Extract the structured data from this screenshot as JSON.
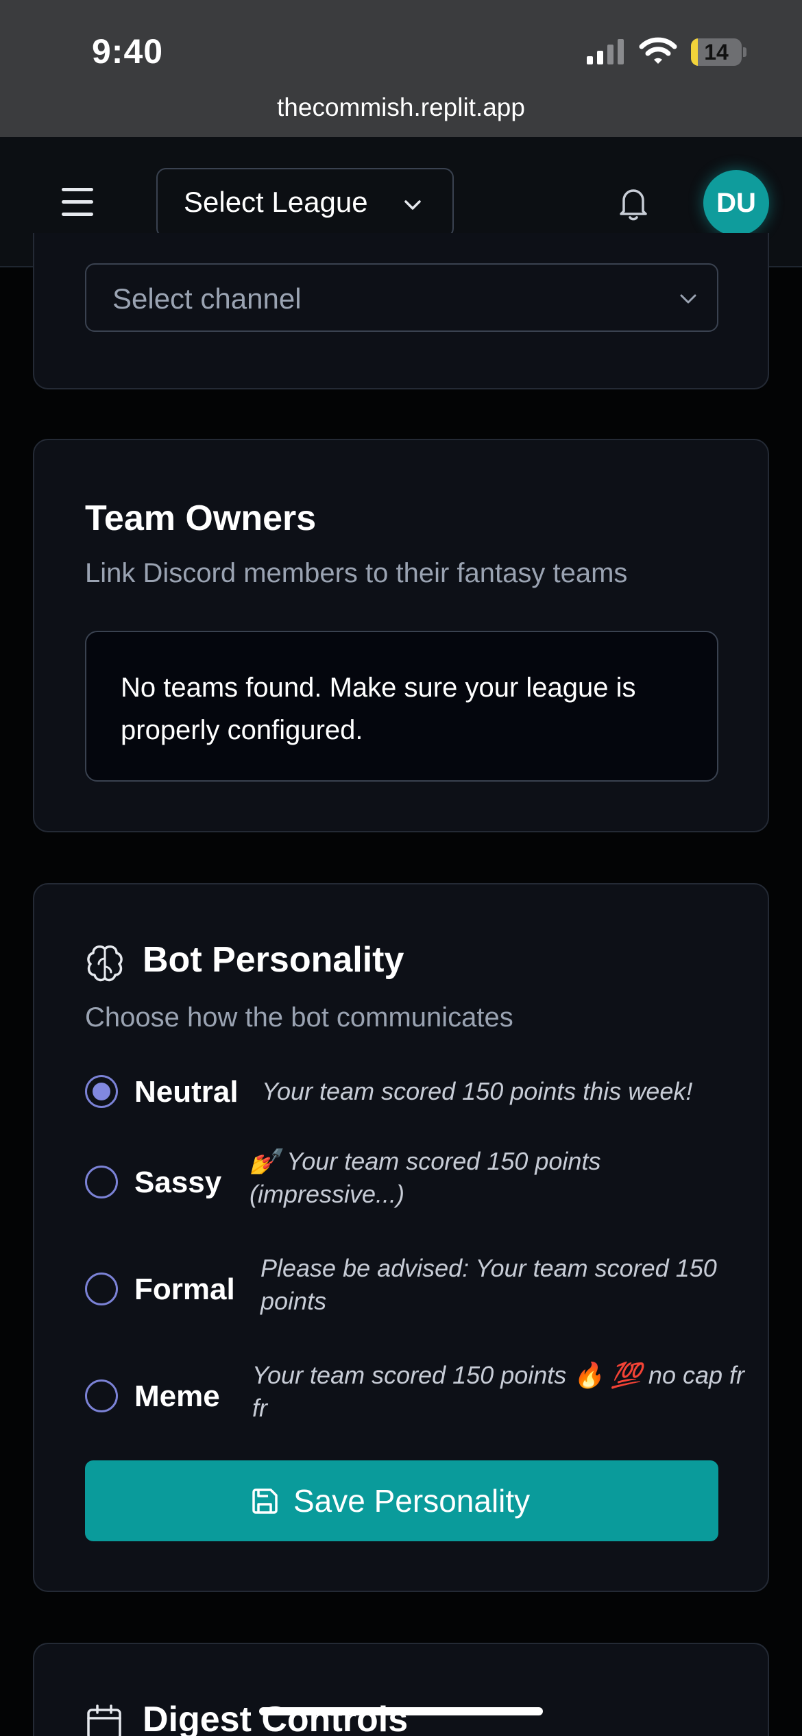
{
  "status": {
    "time": "9:40",
    "battery": "14",
    "battery_level": 0.14
  },
  "browser": {
    "url": "thecommish.replit.app"
  },
  "header": {
    "league_select": "Select League",
    "avatar_initials": "DU"
  },
  "channel": {
    "placeholder": "Select channel"
  },
  "team_owners": {
    "title": "Team Owners",
    "subtitle": "Link Discord members to their fantasy teams",
    "empty_message": "No teams found. Make sure your league is properly configured."
  },
  "personality": {
    "title": "Bot Personality",
    "subtitle": "Choose how the bot communicates",
    "options": [
      {
        "label": "Neutral",
        "example": "Your team scored 150 points this week!",
        "selected": true
      },
      {
        "label": "Sassy",
        "example": "💅 Your team scored 150 points (impressive...)",
        "selected": false
      },
      {
        "label": "Formal",
        "example": "Please be advised: Your team scored 150 points",
        "selected": false
      },
      {
        "label": "Meme",
        "example": "Your team scored 150 points 🔥 💯 no cap fr fr",
        "selected": false
      }
    ],
    "save_label": "Save Personality"
  },
  "digest": {
    "title": "Digest Controls"
  },
  "colors": {
    "accent": "#0a9b9b",
    "radio": "#8188e0",
    "background": "#030405",
    "card": "#0d1017"
  }
}
